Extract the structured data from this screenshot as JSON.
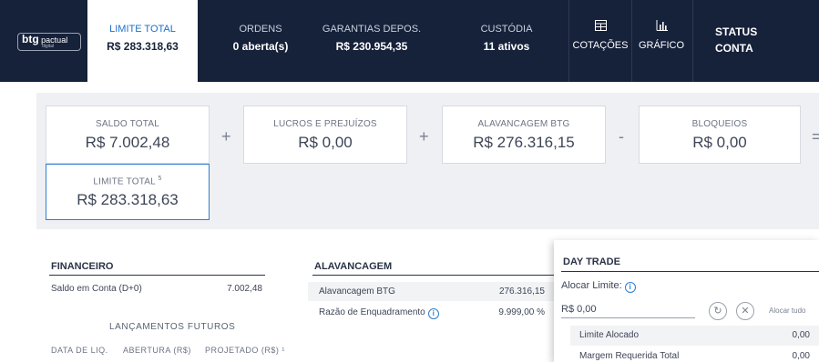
{
  "brand": {
    "logo_main": "btg",
    "logo_side": "pactual",
    "logo_sub": "digital"
  },
  "nav": {
    "limite_total": {
      "label": "LIMITE TOTAL",
      "value": "R$ 283.318,63"
    },
    "ordens": {
      "label": "ORDENS",
      "value": "0 aberta(s)"
    },
    "garantias": {
      "label": "GARANTIAS DEPOS.",
      "value": "R$ 230.954,35"
    },
    "custodia": {
      "label": "CUSTÓDIA",
      "value": "11 ativos"
    },
    "cotacoes": {
      "icon": "table-icon",
      "label": "COTAÇÕES"
    },
    "grafico": {
      "icon": "bar-chart-icon",
      "label": "GRÁFICO"
    },
    "status": {
      "line1": "STATUS",
      "line2": "CONTA"
    }
  },
  "summary": {
    "saldo_total": {
      "label": "SALDO TOTAL",
      "value": "R$ 7.002,48"
    },
    "op1": "+",
    "lucros": {
      "label": "LUCROS E PREJUÍZOS",
      "value": "R$ 0,00"
    },
    "op2": "+",
    "alavancagem": {
      "label": "ALAVANCAGEM BTG",
      "value": "R$ 276.316,15"
    },
    "op3": "-",
    "bloqueios": {
      "label": "BLOQUEIOS",
      "value": "R$ 0,00"
    },
    "op4": "=",
    "limite_total": {
      "label": "LIMITE TOTAL",
      "sup": "5",
      "value": "R$ 283.318,63"
    }
  },
  "financeiro": {
    "title": "FINANCEIRO",
    "saldo_label": "Saldo em Conta (D+0)",
    "saldo_value": "7.002,48",
    "lancamentos_title": "LANÇAMENTOS FUTUROS",
    "columns": [
      "DATA DE LIQ.",
      "ABERTURA (R$)",
      "PROJETADO (R$) ¹"
    ]
  },
  "alavancagem": {
    "title": "ALAVANCAGEM",
    "rows": [
      {
        "label": "Alavancagem BTG",
        "value": "276.316,15"
      },
      {
        "label": "Razão de Enquadramento",
        "value": "9.999,00 %"
      }
    ]
  },
  "day_trade": {
    "title": "DAY TRADE",
    "alocar_label": "Alocar Limite:",
    "input_value": "R$ 0,00",
    "alocar_tudo": "Alocar tudo",
    "rows": [
      {
        "label": "Limite Alocado",
        "value": "0,00"
      },
      {
        "label": "Margem Requerida Total",
        "value": "0,00"
      }
    ]
  }
}
